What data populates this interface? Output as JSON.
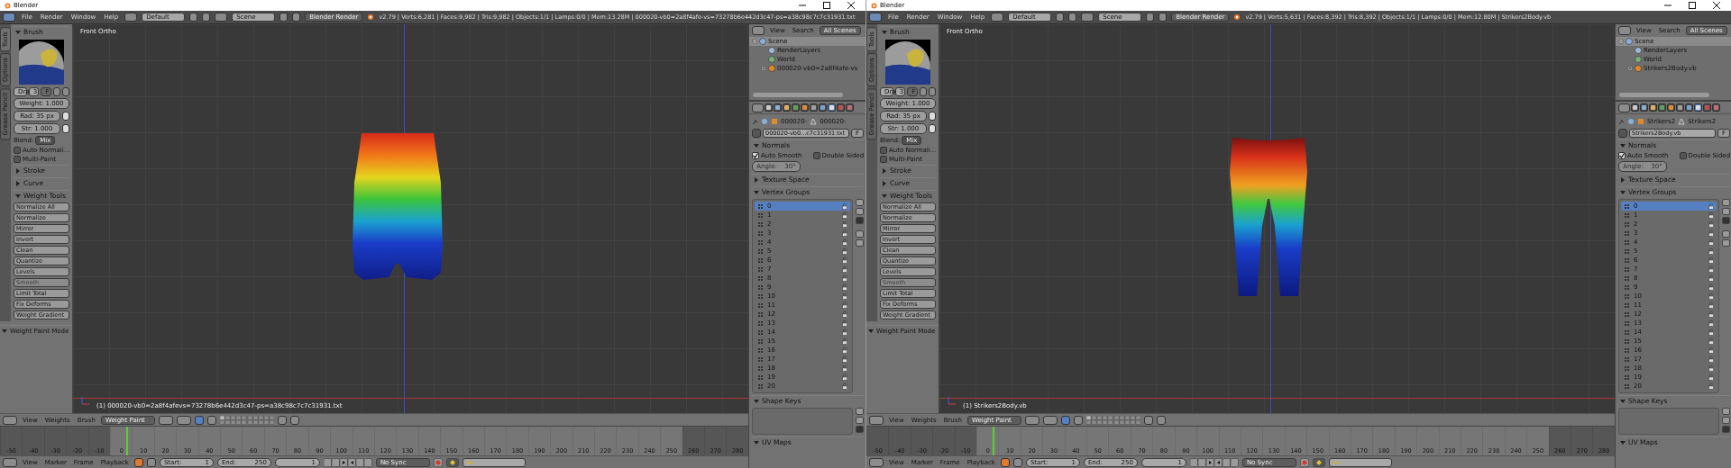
{
  "windows": [
    {
      "title": "Blender",
      "menus": [
        "File",
        "Render",
        "Window",
        "Help"
      ],
      "layout": "Default",
      "scene": "Scene",
      "engine": "Blender Render",
      "stats": "v2.79 | Verts:6,281 | Faces:9,982 | Tris:9,982 | Objects:1/1 | Lamps:0/0 | Mem:13.28M | 000020-vb0=2a8f4afe-vs=73278b6e442d3c47-ps=a38c98c7c7c31931.txt",
      "tool_tabs": [
        {
          "label": "Tools",
          "selected": true
        },
        {
          "label": "Options",
          "selected": false
        },
        {
          "label": "Grease Pencil",
          "selected": false
        }
      ],
      "brush": {
        "label": "Brush",
        "expanded": true,
        "name": "Dra",
        "users": "3",
        "fake": "F",
        "fields": [
          "Weight: 1.000",
          "Rad: 35 px",
          "Str: 1.000"
        ],
        "blend_label": "Blend:",
        "blend": "Mix"
      },
      "options": [
        {
          "label": "Auto Normali...",
          "checked": false
        },
        {
          "label": "Multi-Paint",
          "checked": false
        }
      ],
      "panels": [
        {
          "label": "Stroke",
          "expanded": false
        },
        {
          "label": "Curve",
          "expanded": false
        },
        {
          "label": "Weight Tools",
          "expanded": true,
          "tools": [
            {
              "label": "Normalize All",
              "disabled": false
            },
            {
              "label": "Normalize",
              "disabled": false
            },
            {
              "label": "Mirror",
              "disabled": false
            },
            {
              "label": "Invert",
              "disabled": false
            },
            {
              "label": "Clean",
              "disabled": false
            },
            {
              "label": "Quantize",
              "disabled": false
            },
            {
              "label": "Levels",
              "disabled": false
            },
            {
              "label": "Smooth",
              "disabled": true
            },
            {
              "label": "Limit Total",
              "disabled": false
            },
            {
              "label": "Fix Deforms",
              "disabled": false
            },
            {
              "label": "Weight Gradient",
              "disabled": false
            }
          ]
        }
      ],
      "mode_panel": {
        "label": "Weight Paint Mode",
        "expanded": true
      },
      "viewport": {
        "view_label": "Front Ortho",
        "object_label": "(1) 000020-vb0=2a8f4afevs=73278b6e442d3c47-ps=a38c98c7c7c31931.txt",
        "mesh": {
          "kind": "shorts"
        }
      },
      "view_header": {
        "menus": [
          "View",
          "Weights",
          "Brush"
        ],
        "mode": "Weight Paint"
      },
      "ticks": [
        {
          "label": "-50",
          "in_range": false,
          "current": false
        },
        {
          "label": "-40",
          "in_range": false,
          "current": false
        },
        {
          "label": "-30",
          "in_range": false,
          "current": false
        },
        {
          "label": "-20",
          "in_range": false,
          "current": false
        },
        {
          "label": "-10",
          "in_range": false,
          "current": false
        },
        {
          "label": "0",
          "in_range": true,
          "current": true
        },
        {
          "label": "10",
          "in_range": true,
          "current": false
        },
        {
          "label": "20",
          "in_range": true,
          "current": false
        },
        {
          "label": "30",
          "in_range": true,
          "current": false
        },
        {
          "label": "40",
          "in_range": true,
          "current": false
        },
        {
          "label": "50",
          "in_range": true,
          "current": false
        },
        {
          "label": "60",
          "in_range": true,
          "current": false
        },
        {
          "label": "70",
          "in_range": true,
          "current": false
        },
        {
          "label": "80",
          "in_range": true,
          "current": false
        },
        {
          "label": "90",
          "in_range": true,
          "current": false
        },
        {
          "label": "100",
          "in_range": true,
          "current": false
        },
        {
          "label": "110",
          "in_range": true,
          "current": false
        },
        {
          "label": "120",
          "in_range": true,
          "current": false
        },
        {
          "label": "130",
          "in_range": true,
          "current": false
        },
        {
          "label": "140",
          "in_range": true,
          "current": false
        },
        {
          "label": "150",
          "in_range": true,
          "current": false
        },
        {
          "label": "160",
          "in_range": true,
          "current": false
        },
        {
          "label": "170",
          "in_range": true,
          "current": false
        },
        {
          "label": "180",
          "in_range": true,
          "current": false
        },
        {
          "label": "190",
          "in_range": true,
          "current": false
        },
        {
          "label": "200",
          "in_range": true,
          "current": false
        },
        {
          "label": "210",
          "in_range": true,
          "current": false
        },
        {
          "label": "220",
          "in_range": true,
          "current": false
        },
        {
          "label": "230",
          "in_range": true,
          "current": false
        },
        {
          "label": "240",
          "in_range": true,
          "current": false
        },
        {
          "label": "250",
          "in_range": true,
          "current": false
        },
        {
          "label": "260",
          "in_range": false,
          "current": false
        },
        {
          "label": "270",
          "in_range": false,
          "current": false
        },
        {
          "label": "280",
          "in_range": false,
          "current": false
        }
      ],
      "timeline": {
        "menus": [
          "View",
          "Marker",
          "Frame",
          "Playback"
        ],
        "start_label": "Start:",
        "start": "1",
        "end_label": "End:",
        "end": "250",
        "frame": "1",
        "sync": "No Sync"
      },
      "outliner": {
        "menus": [
          "View",
          "Search"
        ],
        "filter": "All Scenes",
        "tree": [
          {
            "label": "Scene",
            "kind": "scene",
            "selected": true,
            "expanded": true,
            "children": [
              {
                "label": "RenderLayers",
                "kind": "render_layers",
                "selected": false
              },
              {
                "label": "World",
                "kind": "world",
                "selected": false
              },
              {
                "label": "000020-vb0=2a8f4afe-vs",
                "kind": "object",
                "selected": false,
                "expanded": false
              }
            ]
          }
        ]
      },
      "prop_tabs": [
        {
          "kind": "render",
          "selected": false
        },
        {
          "kind": "layers",
          "selected": false
        },
        {
          "kind": "scene",
          "selected": false
        },
        {
          "kind": "world",
          "selected": false
        },
        {
          "kind": "object",
          "selected": false
        },
        {
          "kind": "constraints",
          "selected": false
        },
        {
          "kind": "modifiers",
          "selected": false
        },
        {
          "kind": "data",
          "selected": true
        },
        {
          "kind": "material",
          "selected": false
        },
        {
          "kind": "texture",
          "selected": false
        }
      ],
      "breadcrumb": [
        "000020-",
        "000020-"
      ],
      "data_name": "000020-vb0...c7c31931.txt",
      "fake": "F",
      "sections": [
        {
          "kind": "normals",
          "label": "Normals",
          "expanded": true,
          "auto_smooth": {
            "label": "Auto Smooth",
            "checked": true
          },
          "double_sided": {
            "label": "Double Sided",
            "checked": false
          },
          "angle": {
            "label": "Angle:",
            "value": "30°",
            "disabled": true
          }
        },
        {
          "kind": "texture_space",
          "label": "Texture Space",
          "expanded": false
        },
        {
          "kind": "vertex_groups",
          "label": "Vertex Groups",
          "expanded": true,
          "items": [
            {
              "label": "0",
              "selected": true
            },
            {
              "label": "1",
              "selected": false
            },
            {
              "label": "2",
              "selected": false
            },
            {
              "label": "3",
              "selected": false
            },
            {
              "label": "4",
              "selected": false
            },
            {
              "label": "5",
              "selected": false
            },
            {
              "label": "6",
              "selected": false
            },
            {
              "label": "7",
              "selected": false
            },
            {
              "label": "8",
              "selected": false
            },
            {
              "label": "9",
              "selected": false
            },
            {
              "label": "10",
              "selected": false
            },
            {
              "label": "11",
              "selected": false
            },
            {
              "label": "12",
              "selected": false
            },
            {
              "label": "13",
              "selected": false
            },
            {
              "label": "14",
              "selected": false
            },
            {
              "label": "15",
              "selected": false
            },
            {
              "label": "16",
              "selected": false
            },
            {
              "label": "17",
              "selected": false
            },
            {
              "label": "18",
              "selected": false
            },
            {
              "label": "19",
              "selected": false
            },
            {
              "label": "20",
              "selected": false
            }
          ]
        },
        {
          "kind": "shape_keys",
          "label": "Shape Keys",
          "expanded": true
        },
        {
          "kind": "uv_maps",
          "label": "UV Maps",
          "expanded": true
        }
      ]
    },
    {
      "title": "Blender",
      "menus": [
        "File",
        "Render",
        "Window",
        "Help"
      ],
      "layout": "Default",
      "scene": "Scene",
      "engine": "Blender Render",
      "stats": "v2.79 | Verts:5,631 | Faces:8,392 | Tris:8,392 | Objects:1/1 | Lamps:0/0 | Mem:12.80M | Strikers2Body.vb",
      "tool_tabs": [
        {
          "label": "Tools",
          "selected": true
        },
        {
          "label": "Options",
          "selected": false
        },
        {
          "label": "Grease Pencil",
          "selected": false
        }
      ],
      "brush": {
        "label": "Brush",
        "expanded": true,
        "name": "Dra",
        "users": "3",
        "fake": "F",
        "fields": [
          "Weight: 1.000",
          "Rad: 35 px",
          "Str: 1.000"
        ],
        "blend_label": "Blend:",
        "blend": "Mix"
      },
      "options": [
        {
          "label": "Auto Normali...",
          "checked": false
        },
        {
          "label": "Multi-Paint",
          "checked": false
        }
      ],
      "panels": [
        {
          "label": "Stroke",
          "expanded": false
        },
        {
          "label": "Curve",
          "expanded": false
        },
        {
          "label": "Weight Tools",
          "expanded": true,
          "tools": [
            {
              "label": "Normalize All",
              "disabled": false
            },
            {
              "label": "Normalize",
              "disabled": false
            },
            {
              "label": "Mirror",
              "disabled": false
            },
            {
              "label": "Invert",
              "disabled": false
            },
            {
              "label": "Clean",
              "disabled": false
            },
            {
              "label": "Quantize",
              "disabled": false
            },
            {
              "label": "Levels",
              "disabled": false
            },
            {
              "label": "Smooth",
              "disabled": true
            },
            {
              "label": "Limit Total",
              "disabled": false
            },
            {
              "label": "Fix Deforms",
              "disabled": false
            },
            {
              "label": "Weight Gradient",
              "disabled": false
            }
          ]
        }
      ],
      "mode_panel": {
        "label": "Weight Paint Mode",
        "expanded": true
      },
      "viewport": {
        "view_label": "Front Ortho",
        "object_label": "(1) Strikers2Body.vb",
        "mesh": {
          "kind": "legs"
        }
      },
      "view_header": {
        "menus": [
          "View",
          "Weights",
          "Brush"
        ],
        "mode": "Weight Paint"
      },
      "ticks": [
        {
          "label": "-50",
          "in_range": false,
          "current": false
        },
        {
          "label": "-40",
          "in_range": false,
          "current": false
        },
        {
          "label": "-30",
          "in_range": false,
          "current": false
        },
        {
          "label": "-20",
          "in_range": false,
          "current": false
        },
        {
          "label": "-10",
          "in_range": false,
          "current": false
        },
        {
          "label": "0",
          "in_range": true,
          "current": true
        },
        {
          "label": "10",
          "in_range": true,
          "current": false
        },
        {
          "label": "20",
          "in_range": true,
          "current": false
        },
        {
          "label": "30",
          "in_range": true,
          "current": false
        },
        {
          "label": "40",
          "in_range": true,
          "current": false
        },
        {
          "label": "50",
          "in_range": true,
          "current": false
        },
        {
          "label": "60",
          "in_range": true,
          "current": false
        },
        {
          "label": "70",
          "in_range": true,
          "current": false
        },
        {
          "label": "80",
          "in_range": true,
          "current": false
        },
        {
          "label": "90",
          "in_range": true,
          "current": false
        },
        {
          "label": "100",
          "in_range": true,
          "current": false
        },
        {
          "label": "110",
          "in_range": true,
          "current": false
        },
        {
          "label": "120",
          "in_range": true,
          "current": false
        },
        {
          "label": "130",
          "in_range": true,
          "current": false
        },
        {
          "label": "140",
          "in_range": true,
          "current": false
        },
        {
          "label": "150",
          "in_range": true,
          "current": false
        },
        {
          "label": "160",
          "in_range": true,
          "current": false
        },
        {
          "label": "170",
          "in_range": true,
          "current": false
        },
        {
          "label": "180",
          "in_range": true,
          "current": false
        },
        {
          "label": "190",
          "in_range": true,
          "current": false
        },
        {
          "label": "200",
          "in_range": true,
          "current": false
        },
        {
          "label": "210",
          "in_range": true,
          "current": false
        },
        {
          "label": "220",
          "in_range": true,
          "current": false
        },
        {
          "label": "230",
          "in_range": true,
          "current": false
        },
        {
          "label": "240",
          "in_range": true,
          "current": false
        },
        {
          "label": "250",
          "in_range": true,
          "current": false
        },
        {
          "label": "260",
          "in_range": false,
          "current": false
        },
        {
          "label": "270",
          "in_range": false,
          "current": false
        },
        {
          "label": "280",
          "in_range": false,
          "current": false
        }
      ],
      "timeline": {
        "menus": [
          "View",
          "Marker",
          "Frame",
          "Playback"
        ],
        "start_label": "Start:",
        "start": "1",
        "end_label": "End:",
        "end": "250",
        "frame": "1",
        "sync": "No Sync"
      },
      "outliner": {
        "menus": [
          "View",
          "Search"
        ],
        "filter": "All Scenes",
        "tree": [
          {
            "label": "Scene",
            "kind": "scene",
            "selected": true,
            "expanded": true,
            "children": [
              {
                "label": "RenderLayers",
                "kind": "render_layers",
                "selected": false
              },
              {
                "label": "World",
                "kind": "world",
                "selected": false
              },
              {
                "label": "Strikers2Body.vb",
                "kind": "object",
                "selected": false,
                "expanded": false
              }
            ]
          }
        ]
      },
      "prop_tabs": [
        {
          "kind": "render",
          "selected": false
        },
        {
          "kind": "layers",
          "selected": false
        },
        {
          "kind": "scene",
          "selected": false
        },
        {
          "kind": "world",
          "selected": false
        },
        {
          "kind": "object",
          "selected": false
        },
        {
          "kind": "constraints",
          "selected": false
        },
        {
          "kind": "modifiers",
          "selected": false
        },
        {
          "kind": "data",
          "selected": true
        },
        {
          "kind": "material",
          "selected": false
        },
        {
          "kind": "texture",
          "selected": false
        }
      ],
      "breadcrumb": [
        "Strikers2",
        "Strikers2"
      ],
      "data_name": "Strikers2Body.vb",
      "fake": "F",
      "sections": [
        {
          "kind": "normals",
          "label": "Normals",
          "expanded": true,
          "auto_smooth": {
            "label": "Auto Smooth",
            "checked": true
          },
          "double_sided": {
            "label": "Double Sided",
            "checked": false
          },
          "angle": {
            "label": "Angle:",
            "value": "30°",
            "disabled": true
          }
        },
        {
          "kind": "texture_space",
          "label": "Texture Space",
          "expanded": false
        },
        {
          "kind": "vertex_groups",
          "label": "Vertex Groups",
          "expanded": true,
          "items": [
            {
              "label": "0",
              "selected": true
            },
            {
              "label": "1",
              "selected": false
            },
            {
              "label": "2",
              "selected": false
            },
            {
              "label": "3",
              "selected": false
            },
            {
              "label": "4",
              "selected": false
            },
            {
              "label": "5",
              "selected": false
            },
            {
              "label": "6",
              "selected": false
            },
            {
              "label": "7",
              "selected": false
            },
            {
              "label": "8",
              "selected": false
            },
            {
              "label": "9",
              "selected": false
            },
            {
              "label": "10",
              "selected": false
            },
            {
              "label": "11",
              "selected": false
            },
            {
              "label": "12",
              "selected": false
            },
            {
              "label": "13",
              "selected": false
            },
            {
              "label": "14",
              "selected": false
            },
            {
              "label": "15",
              "selected": false
            },
            {
              "label": "16",
              "selected": false
            },
            {
              "label": "17",
              "selected": false
            },
            {
              "label": "18",
              "selected": false
            },
            {
              "label": "19",
              "selected": false
            },
            {
              "label": "20",
              "selected": false
            }
          ]
        },
        {
          "kind": "shape_keys",
          "label": "Shape Keys",
          "expanded": true
        },
        {
          "kind": "uv_maps",
          "label": "UV Maps",
          "expanded": true
        }
      ]
    }
  ]
}
